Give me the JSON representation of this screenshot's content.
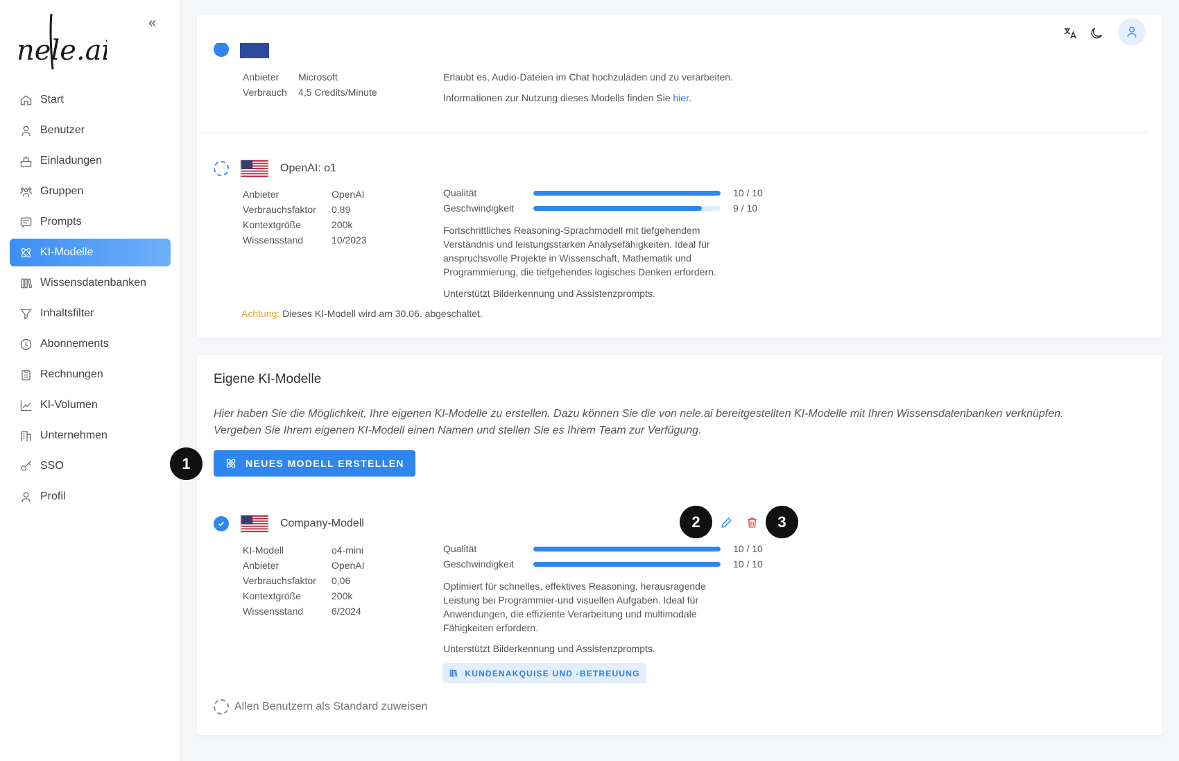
{
  "sidebar": {
    "logo": "nele.ai",
    "items": [
      {
        "label": "Start",
        "icon": "home-icon"
      },
      {
        "label": "Benutzer",
        "icon": "user-icon"
      },
      {
        "label": "Einladungen",
        "icon": "invite-icon"
      },
      {
        "label": "Gruppen",
        "icon": "group-icon"
      },
      {
        "label": "Prompts",
        "icon": "prompt-icon"
      },
      {
        "label": "KI-Modelle",
        "icon": "atom-icon",
        "active": true
      },
      {
        "label": "Wissensdatenbanken",
        "icon": "books-icon"
      },
      {
        "label": "Inhaltsfilter",
        "icon": "filter-icon"
      },
      {
        "label": "Abonnements",
        "icon": "clock-icon"
      },
      {
        "label": "Rechnungen",
        "icon": "clipboard-icon"
      },
      {
        "label": "KI-Volumen",
        "icon": "chart-icon"
      },
      {
        "label": "Unternehmen",
        "icon": "building-icon"
      },
      {
        "label": "SSO",
        "icon": "key-icon"
      },
      {
        "label": "Profil",
        "icon": "user-icon"
      }
    ]
  },
  "audio_model": {
    "anbieter_label": "Anbieter",
    "anbieter": "Microsoft",
    "verbrauch_label": "Verbrauch",
    "verbrauch": "4,5 Credits/Minute",
    "desc": "Erlaubt es, Audio-Dateien im Chat hochzuladen und zu verarbeiten.",
    "info_prefix": "Informationen zur Nutzung dieses Modells finden Sie ",
    "info_link": "hier",
    "info_suffix": "."
  },
  "o1": {
    "name": "OpenAI: o1",
    "fields": [
      {
        "k": "Anbieter",
        "v": "OpenAI"
      },
      {
        "k": "Verbrauchsfaktor",
        "v": "0,89"
      },
      {
        "k": "Kontextgröße",
        "v": "200k"
      },
      {
        "k": "Wissensstand",
        "v": "10/2023"
      }
    ],
    "quality_label": "Qualität",
    "quality": "10 / 10",
    "quality_frac": 1.0,
    "speed_label": "Geschwindigkeit",
    "speed": "9 / 10",
    "speed_frac": 0.9,
    "desc": "Fortschrittliches Reasoning-Sprachmodell mit tiefgehendem Verständnis und leistungsstarken Analysefähigkeiten. Ideal für anspruchsvolle Projekte in Wissenschaft, Mathematik und Programmierung, die tiefgehendes logisches Denken erfordern.",
    "support": "Unterstützt Bilderkennung und Assistenzprompts.",
    "warn_label": "Achtung:",
    "warn_text": " Dieses KI-Modell wird am 30.06. abgeschaltet."
  },
  "custom": {
    "title": "Eigene KI-Modelle",
    "intro1": "Hier haben Sie die Möglichkeit, Ihre eigenen KI-Modelle zu erstellen. Dazu können Sie die von nele.ai bereitgestellten KI-Modelle mit Ihren Wissensdatenbanken verknüpfen.",
    "intro2": "Vergeben Sie Ihrem eigenen KI-Modell einen Namen und stellen Sie es Ihrem Team zur Verfügung.",
    "create_button": "NEUES MODELL ERSTELLEN",
    "model": {
      "name": "Company-Modell",
      "fields": [
        {
          "k": "KI-Modell",
          "v": "o4-mini"
        },
        {
          "k": "Anbieter",
          "v": "OpenAI"
        },
        {
          "k": "Verbrauchsfaktor",
          "v": "0,06"
        },
        {
          "k": "Kontextgröße",
          "v": "200k"
        },
        {
          "k": "Wissensstand",
          "v": "6/2024"
        }
      ],
      "quality_label": "Qualität",
      "quality": "10 / 10",
      "quality_frac": 1.0,
      "speed_label": "Geschwindigkeit",
      "speed": "10 / 10",
      "speed_frac": 1.0,
      "desc": "Optimiert für schnelles, effektives Reasoning, herausragende Leistung bei Programmier-und visuellen Aufgaben. Ideal für Anwendungen, die effiziente Verarbeitung und multimodale Fähigkeiten erfordern.",
      "support": "Unterstützt Bilderkennung und Assistenzprompts.",
      "knowledge_chip": "KUNDENAKQUISE UND -BETREUUNG"
    },
    "default_label": "Allen Benutzern als Standard zuweisen"
  },
  "markers": [
    "1",
    "2",
    "3"
  ],
  "colors": {
    "accent": "#2f86ee",
    "warning": "#f0a030",
    "delete": "#e04848"
  }
}
